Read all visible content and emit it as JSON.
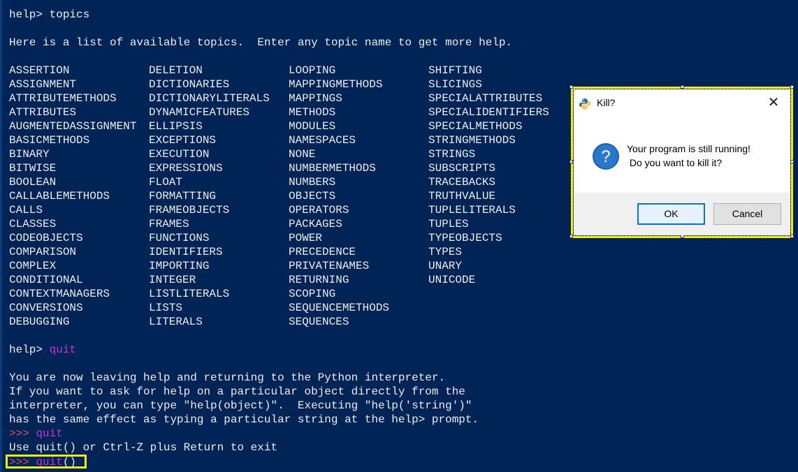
{
  "console": {
    "prompt1": "help> ",
    "cmd1": "topics",
    "intro": "Here is a list of available topics.  Enter any topic name to get more help.",
    "columns": [
      [
        "ASSERTION",
        "ASSIGNMENT",
        "ATTRIBUTEMETHODS",
        "ATTRIBUTES",
        "AUGMENTEDASSIGNMENT",
        "BASICMETHODS",
        "BINARY",
        "BITWISE",
        "BOOLEAN",
        "CALLABLEMETHODS",
        "CALLS",
        "CLASSES",
        "CODEOBJECTS",
        "COMPARISON",
        "COMPLEX",
        "CONDITIONAL",
        "CONTEXTMANAGERS",
        "CONVERSIONS",
        "DEBUGGING"
      ],
      [
        "DELETION",
        "DICTIONARIES",
        "DICTIONARYLITERALS",
        "DYNAMICFEATURES",
        "ELLIPSIS",
        "EXCEPTIONS",
        "EXECUTION",
        "EXPRESSIONS",
        "FLOAT",
        "FORMATTING",
        "FRAMEOBJECTS",
        "FRAMES",
        "FUNCTIONS",
        "IDENTIFIERS",
        "IMPORTING",
        "INTEGER",
        "LISTLITERALS",
        "LISTS",
        "LITERALS"
      ],
      [
        "LOOPING",
        "MAPPINGMETHODS",
        "MAPPINGS",
        "METHODS",
        "MODULES",
        "NAMESPACES",
        "NONE",
        "NUMBERMETHODS",
        "NUMBERS",
        "OBJECTS",
        "OPERATORS",
        "PACKAGES",
        "POWER",
        "PRECEDENCE",
        "PRIVATENAMES",
        "RETURNING",
        "SCOPING",
        "SEQUENCEMETHODS",
        "SEQUENCES"
      ],
      [
        "SHIFTING",
        "SLICINGS",
        "SPECIALATTRIBUTES",
        "SPECIALIDENTIFIERS",
        "SPECIALMETHODS",
        "STRINGMETHODS",
        "STRINGS",
        "SUBSCRIPTS",
        "TRACEBACKS",
        "TRUTHVALUE",
        "TUPLELITERALS",
        "TUPLES",
        "TYPEOBJECTS",
        "TYPES",
        "UNARY",
        "UNICODE"
      ]
    ],
    "prompt2": "help> ",
    "cmd2": "quit",
    "leaving": [
      "You are now leaving help and returning to the Python interpreter.",
      "If you want to ask for help on a particular object directly from the",
      "interpreter, you can type \"help(object)\".  Executing \"help('string')\"",
      "has the same effect as typing a particular string at the help> prompt."
    ],
    "py_prompt": ">>> ",
    "cmd3": "quit",
    "quit_msg": "Use quit() or Ctrl-Z plus Return to exit",
    "cmd4_name": "quit",
    "cmd4_parens": "()"
  },
  "dialog": {
    "title": "Kill?",
    "close_glyph": "✕",
    "message_line1": "Your program is still running!",
    "message_line2": " Do you want to kill it?",
    "ok_label": "OK",
    "cancel_label": "Cancel",
    "title_icon": "python-icon",
    "message_icon": "question-icon",
    "highlight_color": "#f5ec00"
  }
}
